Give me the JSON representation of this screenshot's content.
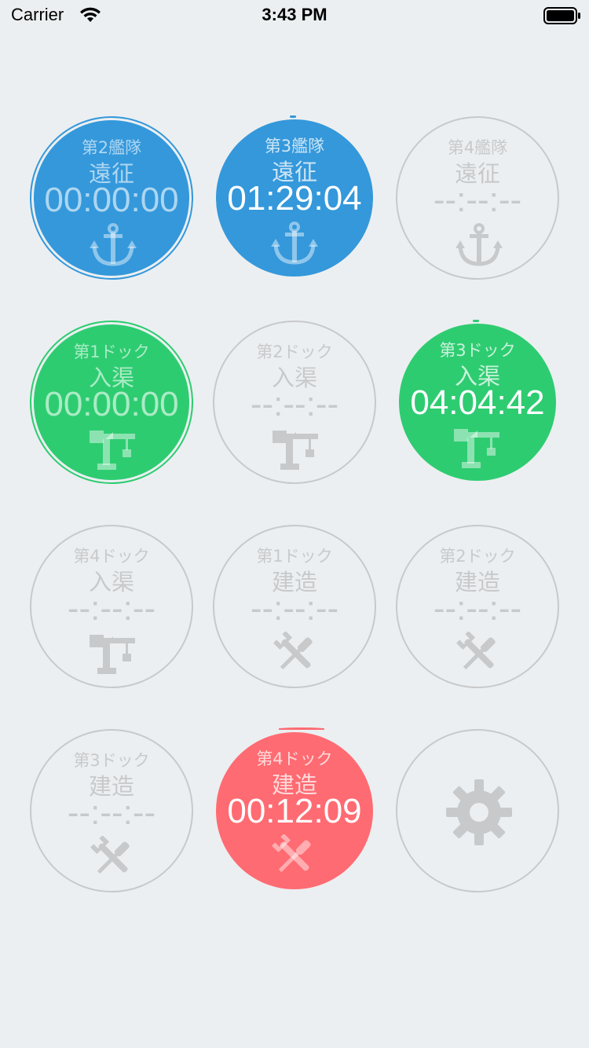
{
  "status_bar": {
    "carrier": "Carrier",
    "time": "3:43 PM"
  },
  "colors": {
    "background": "#eceff1",
    "expedition": "#3498db",
    "dock": "#2ecc71",
    "build": "#ff6b72",
    "inactive": "#c8c9cb"
  },
  "tiles": [
    {
      "title": "第2艦隊",
      "kind": "遠征",
      "timer": "00:00:00",
      "icon": "anchor-icon",
      "state": "finished",
      "color": "#3498db"
    },
    {
      "title": "第3艦隊",
      "kind": "遠征",
      "timer": "01:29:04",
      "icon": "anchor-icon",
      "state": "running",
      "color": "#3498db"
    },
    {
      "title": "第4艦隊",
      "kind": "遠征",
      "timer": "--:--:--",
      "icon": "anchor-icon",
      "state": "idle",
      "color": "#c8c9cb"
    },
    {
      "title": "第1ドック",
      "kind": "入渠",
      "timer": "00:00:00",
      "icon": "crane-icon",
      "state": "finished",
      "color": "#2ecc71"
    },
    {
      "title": "第2ドック",
      "kind": "入渠",
      "timer": "--:--:--",
      "icon": "crane-icon",
      "state": "idle",
      "color": "#c8c9cb"
    },
    {
      "title": "第3ドック",
      "kind": "入渠",
      "timer": "04:04:42",
      "icon": "crane-icon",
      "state": "running",
      "color": "#2ecc71"
    },
    {
      "title": "第4ドック",
      "kind": "入渠",
      "timer": "--:--:--",
      "icon": "crane-icon",
      "state": "idle",
      "color": "#c8c9cb"
    },
    {
      "title": "第1ドック",
      "kind": "建造",
      "timer": "--:--:--",
      "icon": "wrench-screwdriver-icon",
      "state": "idle",
      "color": "#c8c9cb"
    },
    {
      "title": "第2ドック",
      "kind": "建造",
      "timer": "--:--:--",
      "icon": "wrench-screwdriver-icon",
      "state": "idle",
      "color": "#c8c9cb"
    },
    {
      "title": "第3ドック",
      "kind": "建造",
      "timer": "--:--:--",
      "icon": "wrench-screwdriver-icon",
      "state": "idle",
      "color": "#c8c9cb"
    },
    {
      "title": "第4ドック",
      "kind": "建造",
      "timer": "00:12:09",
      "icon": "wrench-screwdriver-icon",
      "state": "running",
      "color": "#ff6b72"
    },
    {
      "icon": "gear-icon",
      "state": "settings",
      "color": "#c8c9cb"
    }
  ]
}
